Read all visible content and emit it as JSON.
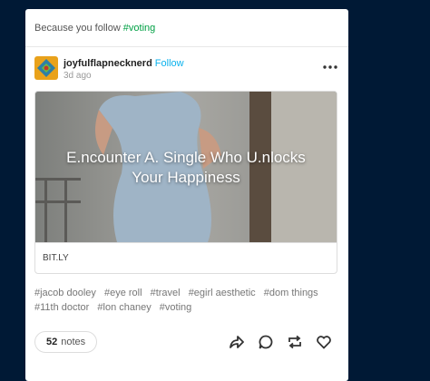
{
  "recommendation": {
    "prefix": "Because you follow",
    "tag": "#voting"
  },
  "post": {
    "username": "joyfulflapnecknerd",
    "follow_label": "Follow",
    "time_ago": "3d ago",
    "link": {
      "title_line1": "E.ncounter A. Single Who U.nlocks",
      "title_line2": "Your Happiness",
      "domain": "BIT.LY"
    },
    "tags": [
      "#jacob dooley",
      "#eye roll",
      "#travel",
      "#egirl aesthetic",
      "#dom things",
      "#11th doctor",
      "#lon chaney",
      "#voting"
    ],
    "notes_count": "52",
    "notes_label": "notes"
  },
  "icons": [
    "more-options-icon",
    "share-icon",
    "reply-icon",
    "reblog-icon",
    "like-icon"
  ],
  "colors": {
    "background": "#001935",
    "tag_green": "#00a044",
    "follow_blue": "#0ab1ec"
  }
}
